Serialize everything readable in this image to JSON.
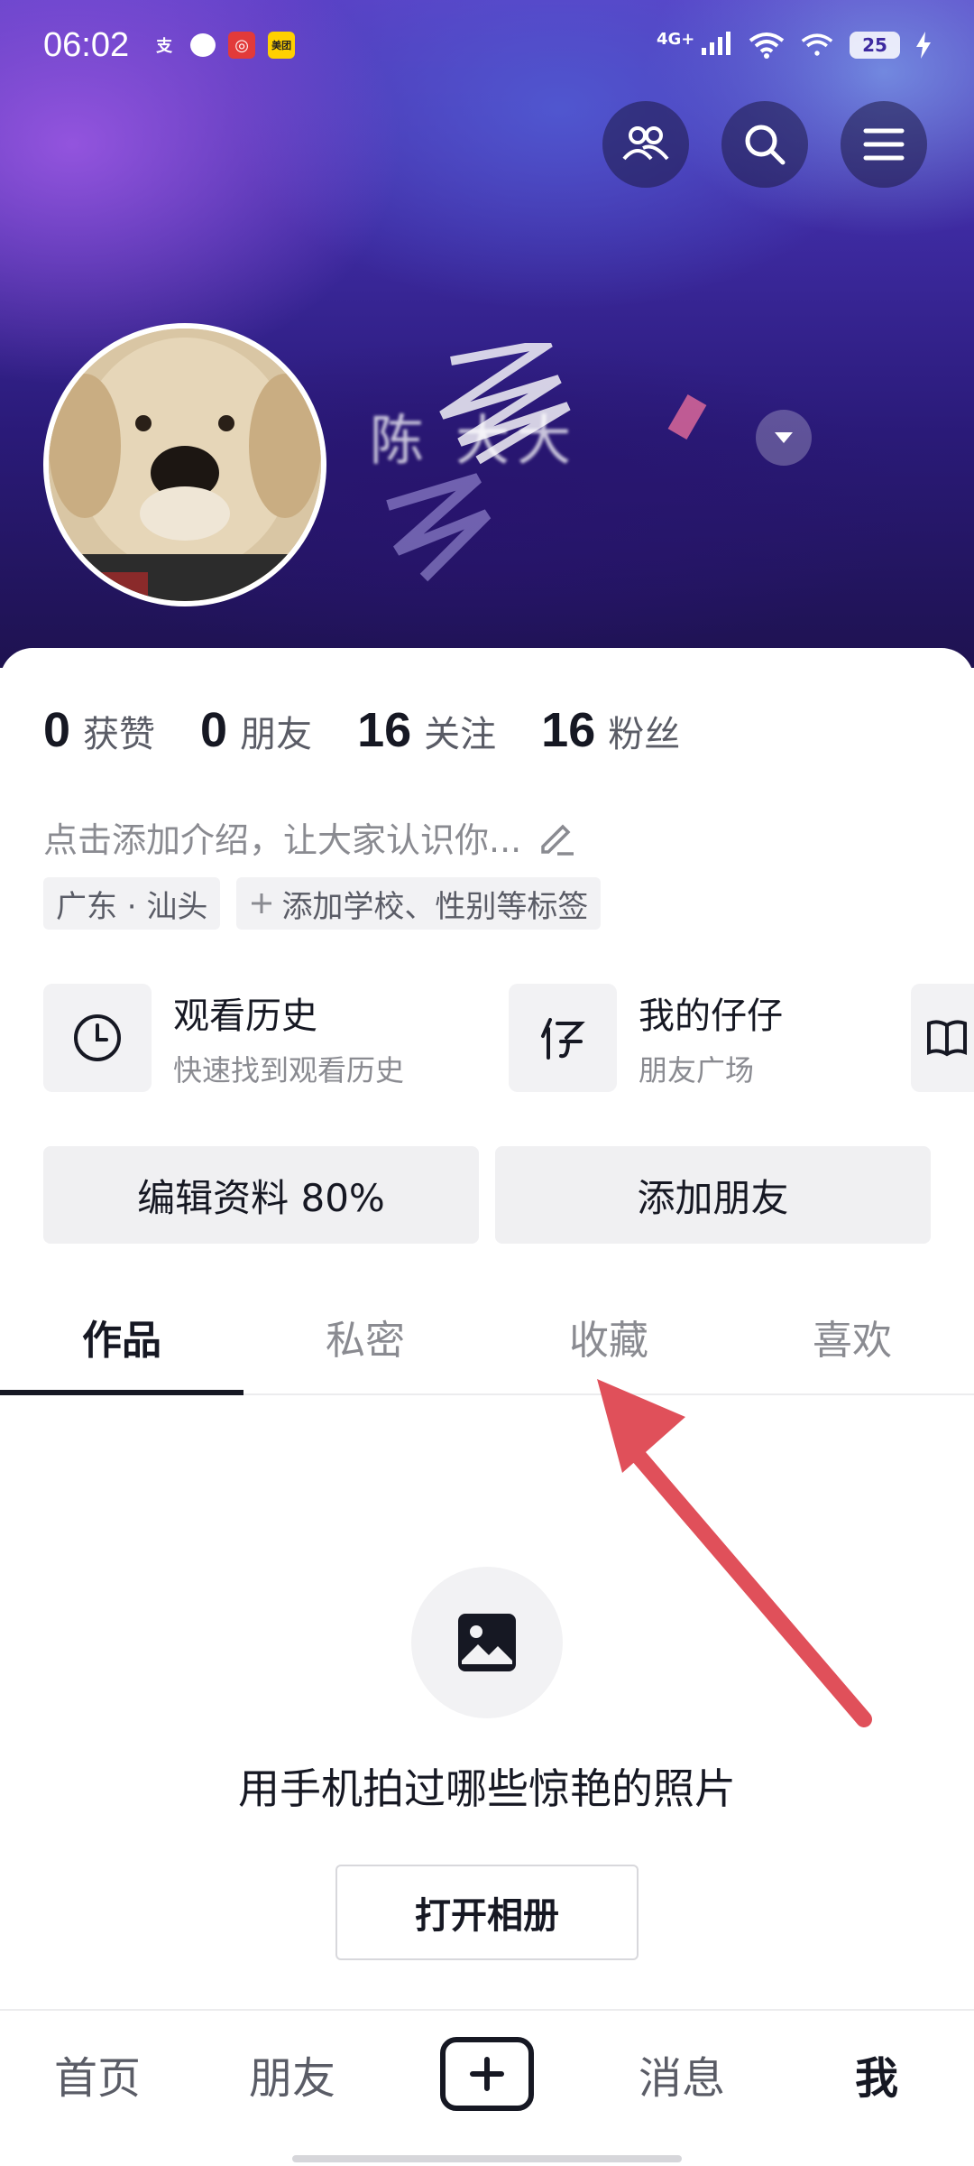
{
  "status_bar": {
    "time": "06:02",
    "network": "4G+",
    "battery": "25",
    "apps": [
      "支",
      "●",
      "网",
      "美团"
    ]
  },
  "profile": {
    "nickname": "陈 大大",
    "stats": [
      {
        "num": "0",
        "label": "获赞"
      },
      {
        "num": "0",
        "label": "朋友"
      },
      {
        "num": "16",
        "label": "关注"
      },
      {
        "num": "16",
        "label": "粉丝"
      }
    ],
    "bio": "点击添加介绍，让大家认识你...",
    "tags": [
      "广东 · 汕头",
      "添加学校、性别等标签"
    ]
  },
  "shortcuts": [
    {
      "title": "观看历史",
      "subtitle": "快速找到观看历史",
      "icon": "clock-icon"
    },
    {
      "title": "我的仔仔",
      "subtitle": "朋友广场",
      "icon": "zaizai-icon"
    }
  ],
  "actions": {
    "edit_profile": "编辑资料 80%",
    "add_friends": "添加朋友"
  },
  "tabs": [
    "作品",
    "私密",
    "收藏",
    "喜欢"
  ],
  "active_tab": "作品",
  "empty_state": {
    "message": "用手机拍过哪些惊艳的照片",
    "button": "打开相册"
  },
  "bottom_nav": {
    "home": "首页",
    "friends": "朋友",
    "messages": "消息",
    "me": "我"
  },
  "colors": {
    "accent_dark": "#161823",
    "annotation_arrow": "#e0505a",
    "banner_purple": "#3d2aa0"
  }
}
